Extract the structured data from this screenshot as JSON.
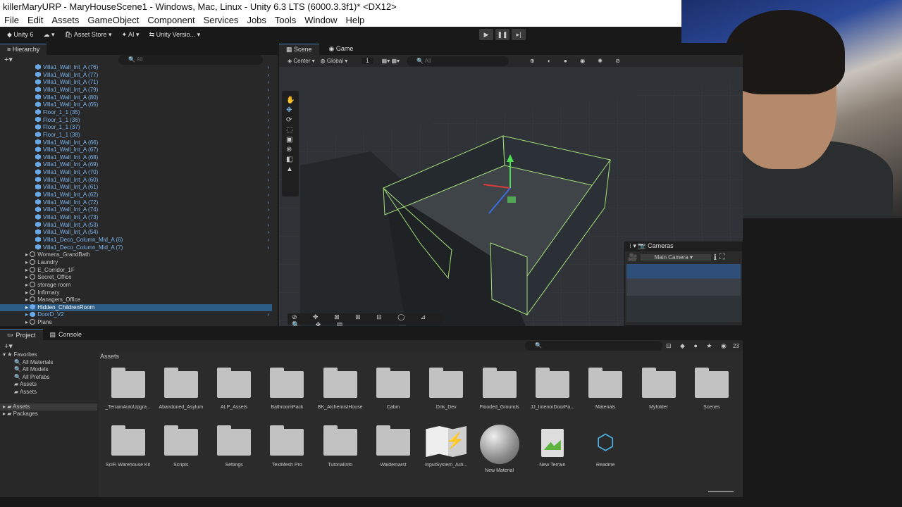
{
  "title": "killerMaryURP - MaryHouseScene1 - Windows, Mac, Linux - Unity 6.3 LTS (6000.3.3f1)* <DX12>",
  "menu": [
    "File",
    "Edit",
    "Assets",
    "GameObject",
    "Component",
    "Services",
    "Jobs",
    "Tools",
    "Window",
    "Help"
  ],
  "toolbar": {
    "account": "Unity 6",
    "store": "Asset Store",
    "ai": "AI",
    "vc": "Unity Versio..."
  },
  "hierarchy": {
    "tab": "Hierarchy",
    "search_placeholder": "All",
    "items": [
      {
        "label": "Villa1_Wall_Int_A (76)",
        "kind": "prefab"
      },
      {
        "label": "Villa1_Wall_Int_A (77)",
        "kind": "prefab"
      },
      {
        "label": "Villa1_Wall_Int_A (71)",
        "kind": "prefab"
      },
      {
        "label": "Villa1_Wall_Int_A (79)",
        "kind": "prefab"
      },
      {
        "label": "Villa1_Wall_Int_A (80)",
        "kind": "prefab"
      },
      {
        "label": "Villa1_Wall_Int_A (65)",
        "kind": "prefab"
      },
      {
        "label": "Floor_1_1 (35)",
        "kind": "prefab"
      },
      {
        "label": "Floor_1_1 (36)",
        "kind": "prefab"
      },
      {
        "label": "Floor_1_1 (37)",
        "kind": "prefab"
      },
      {
        "label": "Floor_1_1 (38)",
        "kind": "prefab"
      },
      {
        "label": "Villa1_Wall_Int_A (66)",
        "kind": "prefab"
      },
      {
        "label": "Villa1_Wall_Int_A (67)",
        "kind": "prefab"
      },
      {
        "label": "Villa1_Wall_Int_A (68)",
        "kind": "prefab"
      },
      {
        "label": "Villa1_Wall_Int_A (69)",
        "kind": "prefab"
      },
      {
        "label": "Villa1_Wall_Int_A (70)",
        "kind": "prefab"
      },
      {
        "label": "Villa1_Wall_Int_A (60)",
        "kind": "prefab"
      },
      {
        "label": "Villa1_Wall_Int_A (61)",
        "kind": "prefab"
      },
      {
        "label": "Villa1_Wall_Int_A (62)",
        "kind": "prefab"
      },
      {
        "label": "Villa1_Wall_Int_A (72)",
        "kind": "prefab"
      },
      {
        "label": "Villa1_Wall_Int_A (74)",
        "kind": "prefab"
      },
      {
        "label": "Villa1_Wall_Int_A (73)",
        "kind": "prefab"
      },
      {
        "label": "Villa1_Wall_Int_A (53)",
        "kind": "prefab"
      },
      {
        "label": "Villa1_Wall_Int_A (54)",
        "kind": "prefab"
      },
      {
        "label": "Villa1_Deco_Column_Mid_A (6)",
        "kind": "prefab"
      },
      {
        "label": "Villa1_Deco_Column_Mid_A (7)",
        "kind": "prefab"
      },
      {
        "label": "Womens_GrandBath",
        "kind": "object"
      },
      {
        "label": "Laundry",
        "kind": "object"
      },
      {
        "label": "E_Corridor_1F",
        "kind": "object"
      },
      {
        "label": "Secret_Office",
        "kind": "object"
      },
      {
        "label": "storage room",
        "kind": "object"
      },
      {
        "label": "Infirmary",
        "kind": "object"
      },
      {
        "label": "Managers_Office",
        "kind": "object"
      },
      {
        "label": "Hidden_ChildrenRoom",
        "kind": "selected"
      },
      {
        "label": "DoorD_V2",
        "kind": "prefab"
      },
      {
        "label": "Plane",
        "kind": "object"
      }
    ]
  },
  "scene": {
    "tabs": [
      "Scene",
      "Game"
    ],
    "pivot": "Center",
    "space": "Global",
    "grid_num": "1",
    "search": "All"
  },
  "cameras": {
    "title": "Cameras",
    "selected": "Main Camera"
  },
  "project": {
    "tabs": [
      "Project",
      "Console"
    ],
    "breadcrumb": "Assets",
    "count": "23",
    "favorites_label": "Favorites",
    "favorites": [
      "All Materials",
      "All Models",
      "All Prefabs",
      "Assets",
      "Assets"
    ],
    "roots": [
      "Assets",
      "Packages"
    ],
    "assets": [
      {
        "label": "_TerrainAutoUpgra...",
        "type": "folder"
      },
      {
        "label": "Abandoned_Asylum",
        "type": "folder"
      },
      {
        "label": "ALP_Assets",
        "type": "folder"
      },
      {
        "label": "BathroomPack",
        "type": "folder"
      },
      {
        "label": "BK_AlchemistHouse",
        "type": "folder"
      },
      {
        "label": "Cabin",
        "type": "folder"
      },
      {
        "label": "Dnk_Dev",
        "type": "folder"
      },
      {
        "label": "Flooded_Grounds",
        "type": "folder"
      },
      {
        "label": "JJ_InteriorDoorPa...",
        "type": "folder"
      },
      {
        "label": "Materials",
        "type": "folder"
      },
      {
        "label": "Myfolder",
        "type": "folder"
      },
      {
        "label": "Scenes",
        "type": "folder"
      },
      {
        "label": "SciFi Warehouse Kit",
        "type": "folder"
      },
      {
        "label": "Scripts",
        "type": "folder"
      },
      {
        "label": "Settings",
        "type": "folder"
      },
      {
        "label": "TextMesh Pro",
        "type": "folder"
      },
      {
        "label": "TutorialInfo",
        "type": "folder"
      },
      {
        "label": "Waldemarst",
        "type": "folder"
      },
      {
        "label": "InputSystem_Acti...",
        "type": "inputactions"
      },
      {
        "label": "New Material",
        "type": "material"
      },
      {
        "label": "New Terrain",
        "type": "terrain"
      },
      {
        "label": "Readme",
        "type": "readme"
      }
    ]
  },
  "colors": {
    "accent": "#3a79bb",
    "prefab": "#7bb4ec",
    "selection": "#2c5d87"
  }
}
